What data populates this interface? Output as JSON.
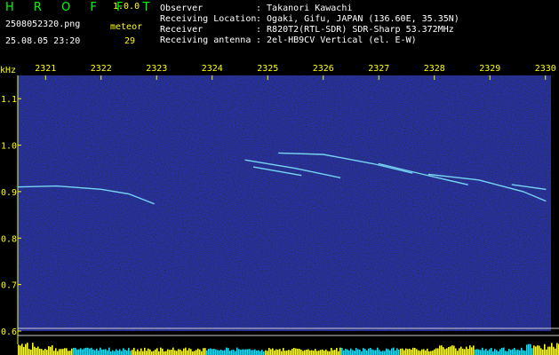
{
  "header": {
    "app_title": "H R O F F T",
    "app_version": "1.0.0",
    "file_name": "2508052320.png",
    "date_time": "25.08.05 23:20",
    "meteor_label": "meteor",
    "meteor_count": "29",
    "info": [
      {
        "key": "Observer",
        "value": ": Takanori Kawachi"
      },
      {
        "key": "Receiving Location",
        "value": ": Ogaki, Gifu, JAPAN (136.60E, 35.35N)"
      },
      {
        "key": "Receiver",
        "value": ": R820T2(RTL-SDR) SDR-Sharp 53.372MHz"
      },
      {
        "key": "Receiving antenna",
        "value": ": 2el-HB9CV Vertical (el. E-W)"
      }
    ]
  },
  "colors": {
    "background": "#000000",
    "plot_noise": "#0a0a5a",
    "title_green": "#00ff00",
    "accent_yellow": "#ffff00",
    "echo_cyan": "#7fe8ff",
    "bottom_bar_cyan": "#00e5ff"
  },
  "chart_data": {
    "type": "heatmap",
    "ylabel": "kHz",
    "x_ticks": [
      "2321",
      "2322",
      "2323",
      "2324",
      "2325",
      "2326",
      "2327",
      "2328",
      "2329",
      "2330"
    ],
    "xlim": [
      2320.5,
      2330.1
    ],
    "y_ticks": [
      "1.1",
      "1.0",
      "0.9",
      "0.8",
      "0.7",
      "0.6"
    ],
    "ylim": [
      0.6,
      1.15
    ],
    "grid": false,
    "carrier_khz": 0.91,
    "echoes": [
      {
        "points": [
          [
            2320.5,
            0.91
          ],
          [
            2321.2,
            0.912
          ],
          [
            2322.0,
            0.905
          ],
          [
            2322.5,
            0.895
          ],
          [
            2322.95,
            0.874
          ]
        ]
      },
      {
        "points": [
          [
            2324.6,
            0.968
          ],
          [
            2325.5,
            0.95
          ],
          [
            2326.3,
            0.93
          ]
        ]
      },
      {
        "points": [
          [
            2324.75,
            0.953
          ],
          [
            2325.6,
            0.935
          ]
        ]
      },
      {
        "points": [
          [
            2325.2,
            0.983
          ],
          [
            2326.0,
            0.98
          ],
          [
            2326.9,
            0.96
          ],
          [
            2327.6,
            0.94
          ]
        ]
      },
      {
        "points": [
          [
            2327.0,
            0.96
          ],
          [
            2327.8,
            0.937
          ],
          [
            2328.6,
            0.915
          ]
        ]
      },
      {
        "points": [
          [
            2327.9,
            0.937
          ],
          [
            2328.8,
            0.925
          ],
          [
            2329.6,
            0.9
          ],
          [
            2330.0,
            0.88
          ]
        ]
      },
      {
        "points": [
          [
            2329.4,
            0.915
          ],
          [
            2330.0,
            0.905
          ]
        ]
      }
    ]
  }
}
